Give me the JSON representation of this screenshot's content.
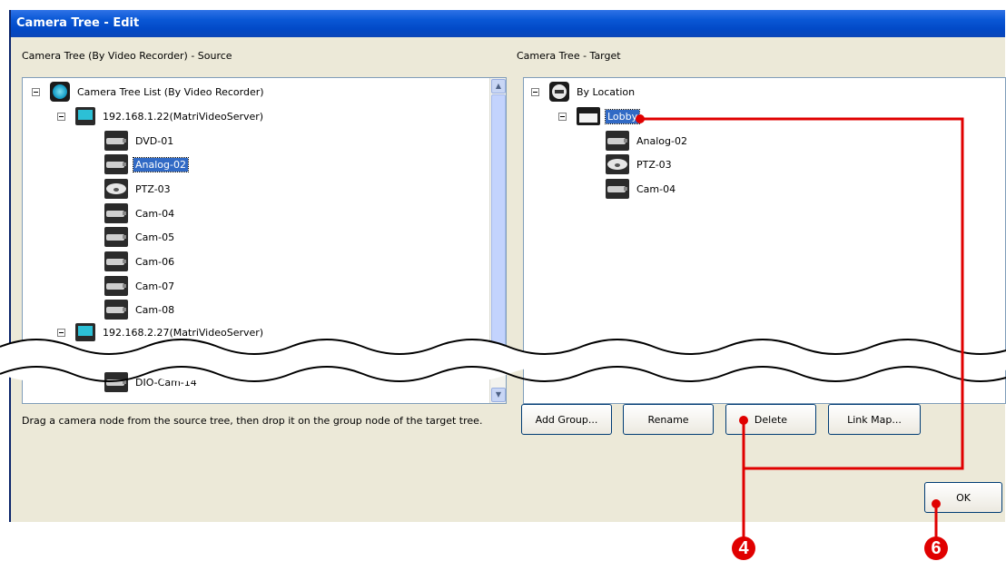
{
  "window": {
    "title": "Camera Tree - Edit"
  },
  "source": {
    "label": "Camera Tree (By Video Recorder) - Source",
    "root": "Camera Tree List (By Video Recorder)",
    "server1": "192.168.1.22(MatriVideoServer)",
    "cameras": [
      "DVD-01",
      "Analog-02",
      "PTZ-03",
      "Cam-04",
      "Cam-05",
      "Cam-06",
      "Cam-07",
      "Cam-08"
    ],
    "selected": "Analog-02",
    "server2": "192.168.2.27(MatriVideoServer)",
    "last_item": "DIO-Cam-14"
  },
  "target": {
    "label": "Camera Tree - Target",
    "root": "By Location",
    "group": "Lobby",
    "cameras": [
      "Analog-02",
      "PTZ-03",
      "Cam-04"
    ]
  },
  "hint": "Drag a camera node from the source tree, then drop it on the group node of the target tree.",
  "buttons": {
    "add_group": "Add Group...",
    "rename": "Rename",
    "delete": "Delete",
    "link_map": "Link Map...",
    "ok": "OK"
  },
  "annotations": {
    "callout_a": "4",
    "callout_b": "6"
  },
  "colors": {
    "annotation": "#e00000",
    "titlebar": "#0a58d6",
    "selection": "#316ac5"
  }
}
